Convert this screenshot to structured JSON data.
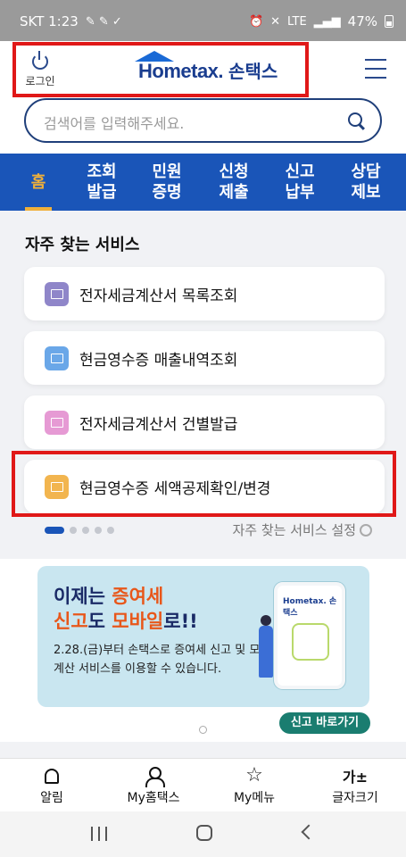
{
  "status_bar": {
    "carrier_time": "SKT 1:23",
    "network": "LTE",
    "battery": "47%"
  },
  "header": {
    "login_label": "로그인",
    "logo_text": "Hometax.",
    "logo_korean": "손택스"
  },
  "search": {
    "placeholder": "검색어를 입력해주세요."
  },
  "tabs": [
    {
      "line1": "홈",
      "line2": ""
    },
    {
      "line1": "조회",
      "line2": "발급"
    },
    {
      "line1": "민원",
      "line2": "증명"
    },
    {
      "line1": "신청",
      "line2": "제출"
    },
    {
      "line1": "신고",
      "line2": "납부"
    },
    {
      "line1": "상담",
      "line2": "제보"
    }
  ],
  "frequent": {
    "title": "자주 찾는 서비스",
    "items": [
      {
        "label": "전자세금계산서 목록조회",
        "color": "#8f86c9",
        "icon": "document-search-icon"
      },
      {
        "label": "현금영수증 매출내역조회",
        "color": "#6aa7e8",
        "icon": "document-search-icon"
      },
      {
        "label": "전자세금계산서 건별발급",
        "color": "#e69ad4",
        "icon": "print-icon"
      },
      {
        "label": "현금영수증 세액공제확인/변경",
        "color": "#f2b54f",
        "icon": "print-icon"
      }
    ],
    "settings_label": "자주 찾는 서비스 설정"
  },
  "banner": {
    "line1_a": "이제는 ",
    "line1_b": "증여세",
    "line2_a": "신고",
    "line2_b": "도 ",
    "line2_c": "모바일",
    "line2_d": "로!!",
    "sub": "2.28.(금)부터 손택스로 증여세 신고 및 모의계산 서비스를 이용할 수 있습니다.",
    "phone_logo": "Hometax. 손택스",
    "button": "신고 바로가기"
  },
  "bottom_nav": [
    {
      "label": "알림",
      "icon": "bell-icon"
    },
    {
      "label": "My홈택스",
      "icon": "user-icon"
    },
    {
      "label": "My메뉴",
      "icon": "star-icon"
    },
    {
      "label": "글자크기",
      "icon": "font-size-icon",
      "glyph": "가±"
    }
  ],
  "colors": {
    "brand_blue": "#1a55b8",
    "accent": "#f0b03a",
    "highlight": "#e01818"
  }
}
